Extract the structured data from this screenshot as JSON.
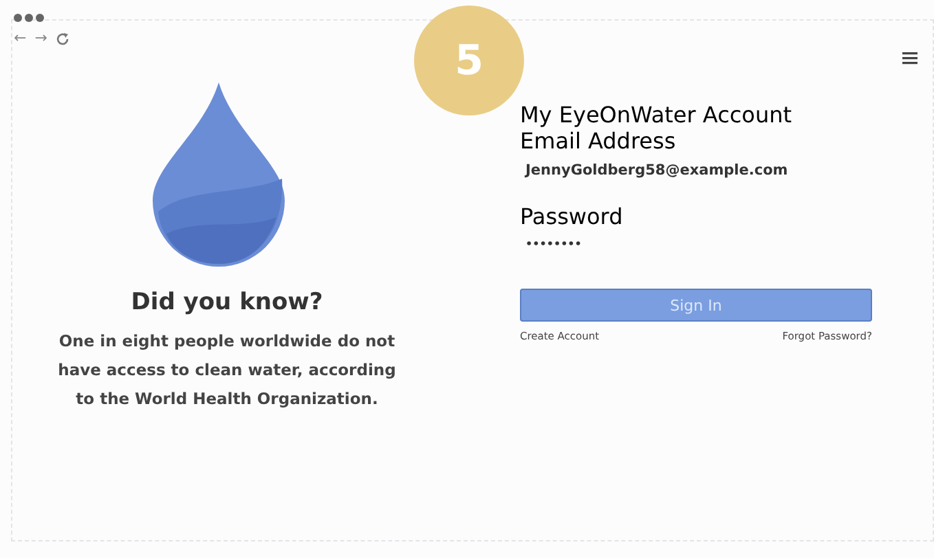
{
  "step_badge": "5",
  "browser": {
    "back": "←",
    "forward": "→"
  },
  "info": {
    "heading": "Did you know?",
    "text": "One in eight people worldwide do not have access to clean water, according to the World Health Organization."
  },
  "login": {
    "title": "My EyeOnWater Account",
    "fields": [
      {
        "label": "Email Address",
        "value": "JennyGoldberg58@example.com",
        "kind": "text"
      },
      {
        "label": "Password",
        "value": "••••••••",
        "kind": "password"
      }
    ],
    "button": "Sign In",
    "links": [
      "Create Account",
      "Forgot Password?"
    ]
  }
}
